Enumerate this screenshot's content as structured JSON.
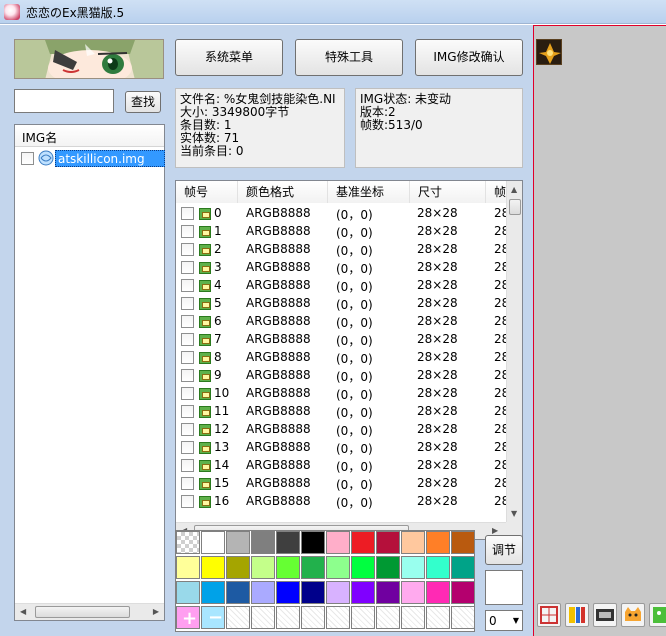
{
  "window": {
    "title": "恋恋のEx黑猫版.5"
  },
  "toolbar": {
    "system_menu": "系统菜单",
    "special_tools": "特殊工具",
    "img_confirm": "IMG修改确认"
  },
  "search": {
    "value": "",
    "button": "查找"
  },
  "img_list": {
    "header": "IMG名",
    "items": [
      {
        "name": "atskillicon.img",
        "selected": true
      }
    ]
  },
  "file_info": {
    "lines": [
      "文件名: %女鬼剑技能染色.NI",
      "大小: 3349800字节",
      "条目数: 1",
      "实体数: 71",
      "当前条目: 0"
    ]
  },
  "img_info": {
    "lines": [
      "IMG状态: 未变动",
      "版本:2",
      "帧数:513/0"
    ]
  },
  "frame_table": {
    "headers": [
      "帧号",
      "颜色格式",
      "基准坐标",
      "尺寸",
      "帧"
    ],
    "rows": [
      {
        "id": "0",
        "format": "ARGB8888",
        "coord": "(0，0)",
        "size": "28×28",
        "extra": "28"
      },
      {
        "id": "1",
        "format": "ARGB8888",
        "coord": "(0，0)",
        "size": "28×28",
        "extra": "28"
      },
      {
        "id": "2",
        "format": "ARGB8888",
        "coord": "(0，0)",
        "size": "28×28",
        "extra": "28"
      },
      {
        "id": "3",
        "format": "ARGB8888",
        "coord": "(0，0)",
        "size": "28×28",
        "extra": "28"
      },
      {
        "id": "4",
        "format": "ARGB8888",
        "coord": "(0，0)",
        "size": "28×28",
        "extra": "28"
      },
      {
        "id": "5",
        "format": "ARGB8888",
        "coord": "(0，0)",
        "size": "28×28",
        "extra": "28"
      },
      {
        "id": "6",
        "format": "ARGB8888",
        "coord": "(0，0)",
        "size": "28×28",
        "extra": "28"
      },
      {
        "id": "7",
        "format": "ARGB8888",
        "coord": "(0，0)",
        "size": "28×28",
        "extra": "28"
      },
      {
        "id": "8",
        "format": "ARGB8888",
        "coord": "(0，0)",
        "size": "28×28",
        "extra": "28"
      },
      {
        "id": "9",
        "format": "ARGB8888",
        "coord": "(0，0)",
        "size": "28×28",
        "extra": "28"
      },
      {
        "id": "10",
        "format": "ARGB8888",
        "coord": "(0，0)",
        "size": "28×28",
        "extra": "28"
      },
      {
        "id": "11",
        "format": "ARGB8888",
        "coord": "(0，0)",
        "size": "28×28",
        "extra": "28"
      },
      {
        "id": "12",
        "format": "ARGB8888",
        "coord": "(0，0)",
        "size": "28×28",
        "extra": "28"
      },
      {
        "id": "13",
        "format": "ARGB8888",
        "coord": "(0，0)",
        "size": "28×28",
        "extra": "28"
      },
      {
        "id": "14",
        "format": "ARGB8888",
        "coord": "(0，0)",
        "size": "28×28",
        "extra": "28"
      },
      {
        "id": "15",
        "format": "ARGB8888",
        "coord": "(0，0)",
        "size": "28×28",
        "extra": "28"
      },
      {
        "id": "16",
        "format": "ARGB8888",
        "coord": "(0，0)",
        "size": "28×28",
        "extra": "28"
      }
    ]
  },
  "palette": {
    "colors": [
      [
        "transparent",
        "#ffffff",
        "#b4b4b4",
        "#7f7f7f",
        "#3f3f3f",
        "#000000",
        "#ffaec9",
        "#ed1c24",
        "#b5103b",
        "#ffc89e",
        "#ff7f27",
        "#b95a0f"
      ],
      [
        "#ffff99",
        "#ffff00",
        "#a5a500",
        "#c4ff8a",
        "#66ff33",
        "#22b14c",
        "#8dff8d",
        "#00ff40",
        "#009933",
        "#99ffee",
        "#33ffcc",
        "#00a388"
      ],
      [
        "#99d9ea",
        "#00a2e8",
        "#1d5aa3",
        "#aaaaff",
        "#0000ff",
        "#00008b",
        "#d8b2ff",
        "#8000ff",
        "#7000a0",
        "#ffaaee",
        "#ff2ab4",
        "#b4006e"
      ],
      [
        "plus",
        "minus",
        "empty",
        "empty",
        "empty",
        "empty",
        "empty",
        "empty",
        "empty",
        "empty",
        "empty",
        "empty"
      ]
    ],
    "adjust_button": "调节",
    "dropdown_value": "0"
  },
  "bottom_icons": [
    "frame-grid-icon",
    "palette-bars-icon",
    "film-icon",
    "cat-face-icon",
    "green-sprite-icon"
  ]
}
